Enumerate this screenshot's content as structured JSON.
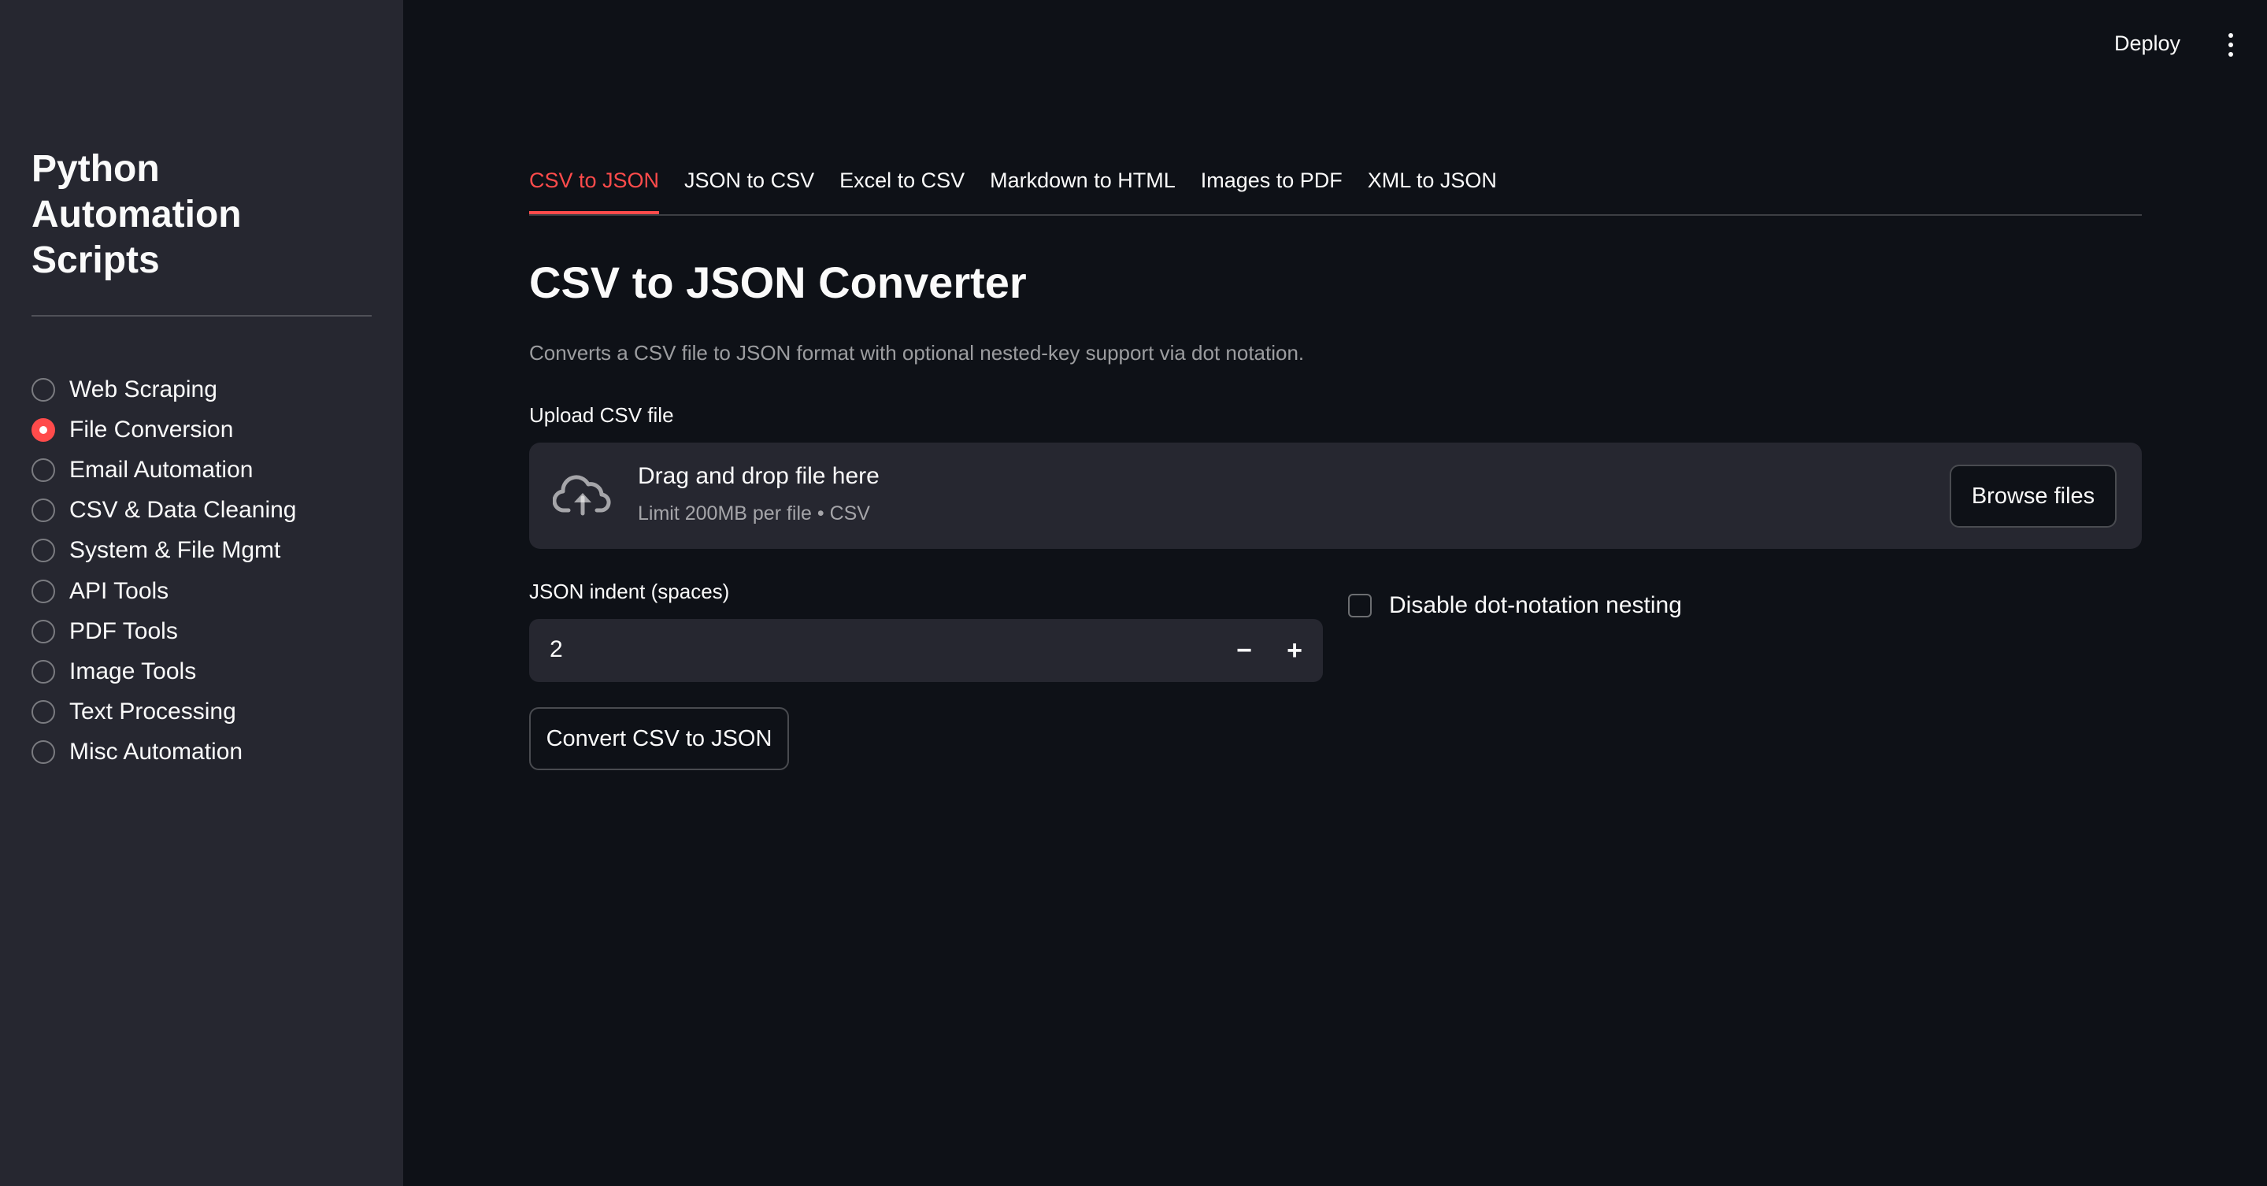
{
  "header": {
    "deploy_label": "Deploy",
    "menu_icon": "vertical-ellipsis-icon"
  },
  "sidebar": {
    "title": "Python Automation Scripts",
    "selected": "File Conversion",
    "items": [
      {
        "label": "Web Scraping",
        "selected": false
      },
      {
        "label": "File Conversion",
        "selected": true
      },
      {
        "label": "Email Automation",
        "selected": false
      },
      {
        "label": "CSV & Data Cleaning",
        "selected": false
      },
      {
        "label": "System & File Mgmt",
        "selected": false
      },
      {
        "label": "API Tools",
        "selected": false
      },
      {
        "label": "PDF Tools",
        "selected": false
      },
      {
        "label": "Image Tools",
        "selected": false
      },
      {
        "label": "Text Processing",
        "selected": false
      },
      {
        "label": "Misc Automation",
        "selected": false
      }
    ]
  },
  "main": {
    "tabs": [
      {
        "label": "CSV to JSON",
        "active": true
      },
      {
        "label": "JSON to CSV",
        "active": false
      },
      {
        "label": "Excel to CSV",
        "active": false
      },
      {
        "label": "Markdown to HTML",
        "active": false
      },
      {
        "label": "Images to PDF",
        "active": false
      },
      {
        "label": "XML to JSON",
        "active": false
      }
    ],
    "heading": "CSV to JSON Converter",
    "description": "Converts a CSV file to JSON format with optional nested-key support via dot notation.",
    "uploader": {
      "label": "Upload CSV file",
      "icon": "cloud-upload-icon",
      "title": "Drag and drop file here",
      "limit": "Limit 200MB per file • CSV",
      "browse_label": "Browse files"
    },
    "indent": {
      "label": "JSON indent (spaces)",
      "value": "2",
      "minus": "−",
      "plus": "+"
    },
    "checkbox": {
      "label": "Disable dot-notation nesting",
      "checked": false
    },
    "convert_label": "Convert CSV to JSON"
  },
  "colors": {
    "background": "#0e1117",
    "sidebar": "#262730",
    "accent": "#ff4b4b",
    "text": "#fafafa"
  }
}
